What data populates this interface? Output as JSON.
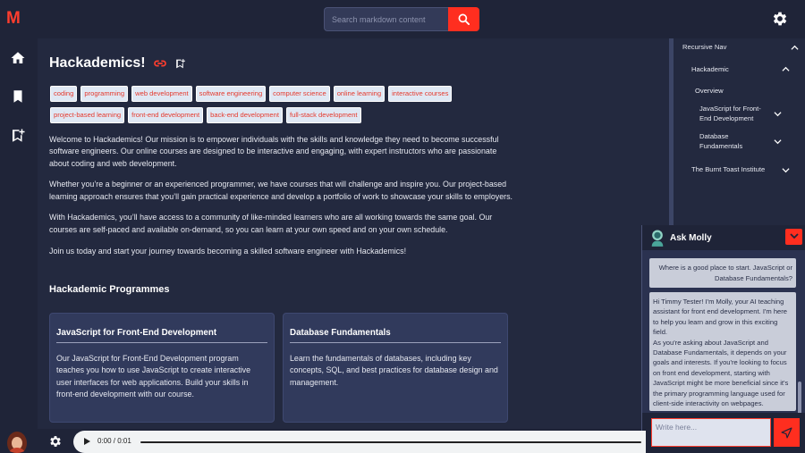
{
  "header": {
    "logo": "M",
    "search_placeholder": "Search markdown content"
  },
  "main": {
    "title": "Hackademics!",
    "tags": [
      "coding",
      "programming",
      "web development",
      "software engineering",
      "computer science",
      "online learning",
      "interactive courses",
      "project-based learning",
      "front-end development",
      "back-end development",
      "full-stack development"
    ],
    "paragraphs": [
      "Welcome to Hackademics! Our mission is to empower individuals with the skills and knowledge they need to become successful software engineers. Our online courses are designed to be interactive and engaging, with expert instructors who are passionate about coding and web development.",
      "Whether you’re a beginner or an experienced programmer, we have courses that will challenge and inspire you. Our project-based learning approach ensures that you’ll gain practical experience and develop a portfolio of work to showcase your skills to employers.",
      "With Hackademics, you’ll have access to a community of like-minded learners who are all working towards the same goal. Our courses are self-paced and available on-demand, so you can learn at your own speed and on your own schedule.",
      "Join us today and start your journey towards becoming a skilled software engineer with Hackademics!"
    ],
    "section_title": "Hackademic Programmes",
    "cards": [
      {
        "title": "JavaScript for Front-End Development",
        "body": "Our JavaScript for Front-End Development program teaches you how to use JavaScript to create interactive user interfaces for web applications. Build your skills in front-end development with our course."
      },
      {
        "title": "Database Fundamentals",
        "body": "Learn the fundamentals of databases, including key concepts, SQL, and best practices for database design and management."
      }
    ]
  },
  "nav": {
    "root": "Recursive Nav",
    "group": "Hackademic",
    "items": [
      "Overview",
      "JavaScript for Front-End Development",
      "Database Fundamentals"
    ],
    "other": "The Burnt Toast Institute"
  },
  "chat": {
    "title": "Ask Molly",
    "user_message": "Where is a good place to start. JavaScript or Database Fundamentals?",
    "bot_message_1": "Hi Timmy Tester! I'm Molly, your AI teaching assistant for front end development. I'm here to help you learn and grow in this exciting field.",
    "bot_message_2": "As you're asking about JavaScript and Database Fundamentals, it depends on your goals and interests. If you're looking to focus on front end development, starting with JavaScript might be more beneficial since it's the primary programming language used for client-side interactivity on webpages.",
    "input_placeholder": "Write here..."
  },
  "audio": {
    "time": "0:00 / 0:01"
  },
  "colors": {
    "accent": "#ff2e1f",
    "background": "#23293f",
    "panel": "#1f2438",
    "card": "#313a5c"
  }
}
